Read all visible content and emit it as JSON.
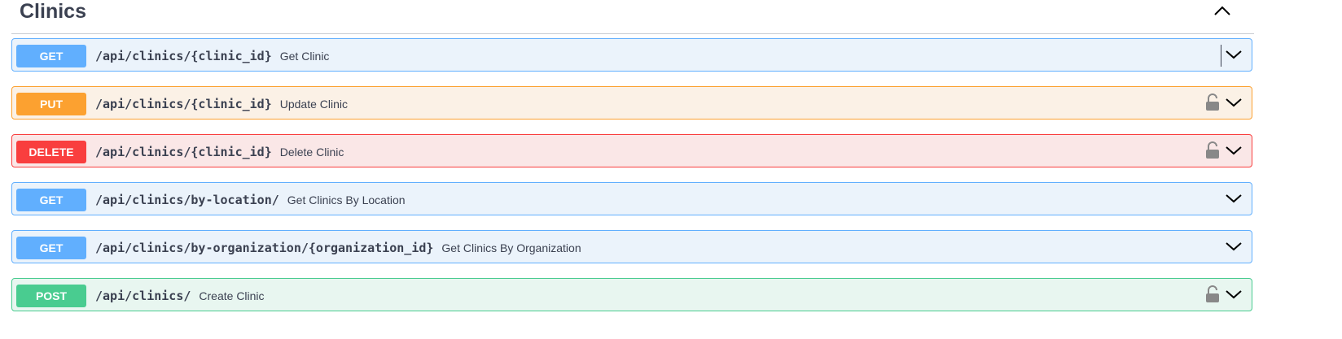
{
  "section": {
    "title": "Clinics",
    "collapse_icon": "chevron-up-icon"
  },
  "operations": [
    {
      "method": "GET",
      "path": "/api/clinics/{clinic_id}",
      "summary": "Get Clinic",
      "locked": false
    },
    {
      "method": "PUT",
      "path": "/api/clinics/{clinic_id}",
      "summary": "Update Clinic",
      "locked": true
    },
    {
      "method": "DELETE",
      "path": "/api/clinics/{clinic_id}",
      "summary": "Delete Clinic",
      "locked": true
    },
    {
      "method": "GET",
      "path": "/api/clinics/by-location/",
      "summary": "Get Clinics By Location",
      "locked": false
    },
    {
      "method": "GET",
      "path": "/api/clinics/by-organization/{organization_id}",
      "summary": "Get Clinics By Organization",
      "locked": false
    },
    {
      "method": "POST",
      "path": "/api/clinics/",
      "summary": "Create Clinic",
      "locked": true
    }
  ],
  "colors": {
    "get": "#61affe",
    "put": "#fca130",
    "delete": "#f93e3e",
    "post": "#49cc90",
    "text": "#3b4151"
  }
}
